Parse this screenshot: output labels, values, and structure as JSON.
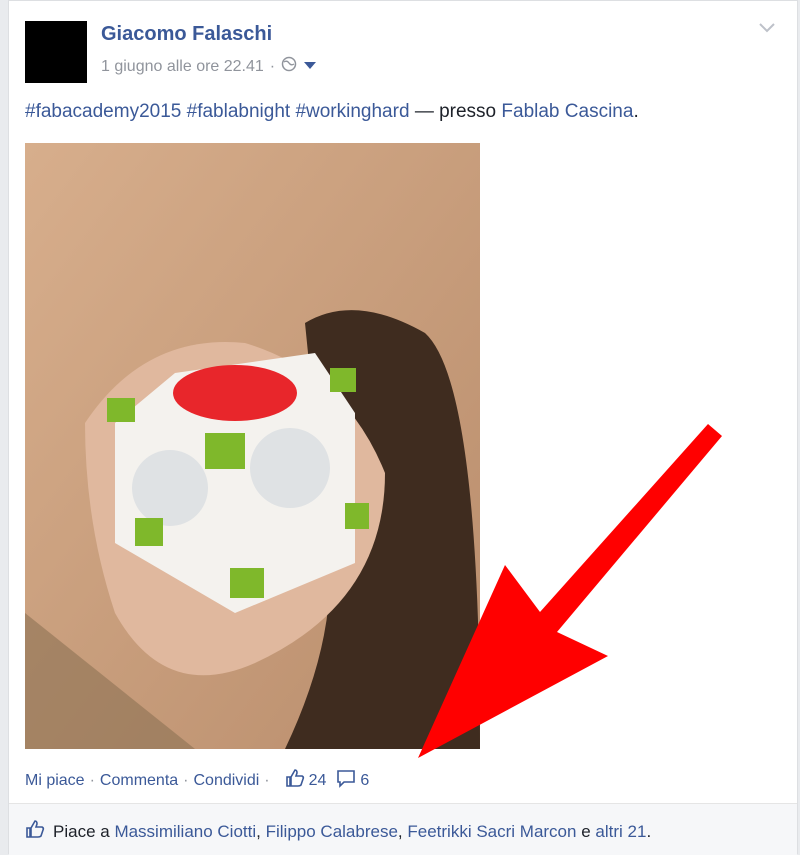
{
  "post": {
    "author": "Giacomo Falaschi",
    "timestamp": "1 giugno alle ore 22.41",
    "dot": "·",
    "hashtags": [
      "#fabacademy2015",
      "#fablabnight",
      "#workinghard"
    ],
    "dash_text": "— presso",
    "place": "Fablab Cascina",
    "period": "."
  },
  "actions": {
    "like": "Mi piace",
    "comment": "Commenta",
    "share": "Condividi",
    "sep": "·",
    "like_count": "24",
    "comment_count": "6"
  },
  "likes": {
    "prefix": "Piace a",
    "people": [
      "Massimiliano Ciotti",
      "Filippo Calabrese",
      "Feetrikki Sacri Marcon"
    ],
    "comma": ",",
    "and": "e",
    "others": "altri 21",
    "period": "."
  },
  "colors": {
    "link": "#3b5998",
    "arrow": "#ff0000",
    "cube_accent": "#7fb82b"
  },
  "icons": [
    "globe-icon",
    "caret-down-icon",
    "chevron-down-icon",
    "thumbs-up-icon",
    "comment-icon"
  ]
}
